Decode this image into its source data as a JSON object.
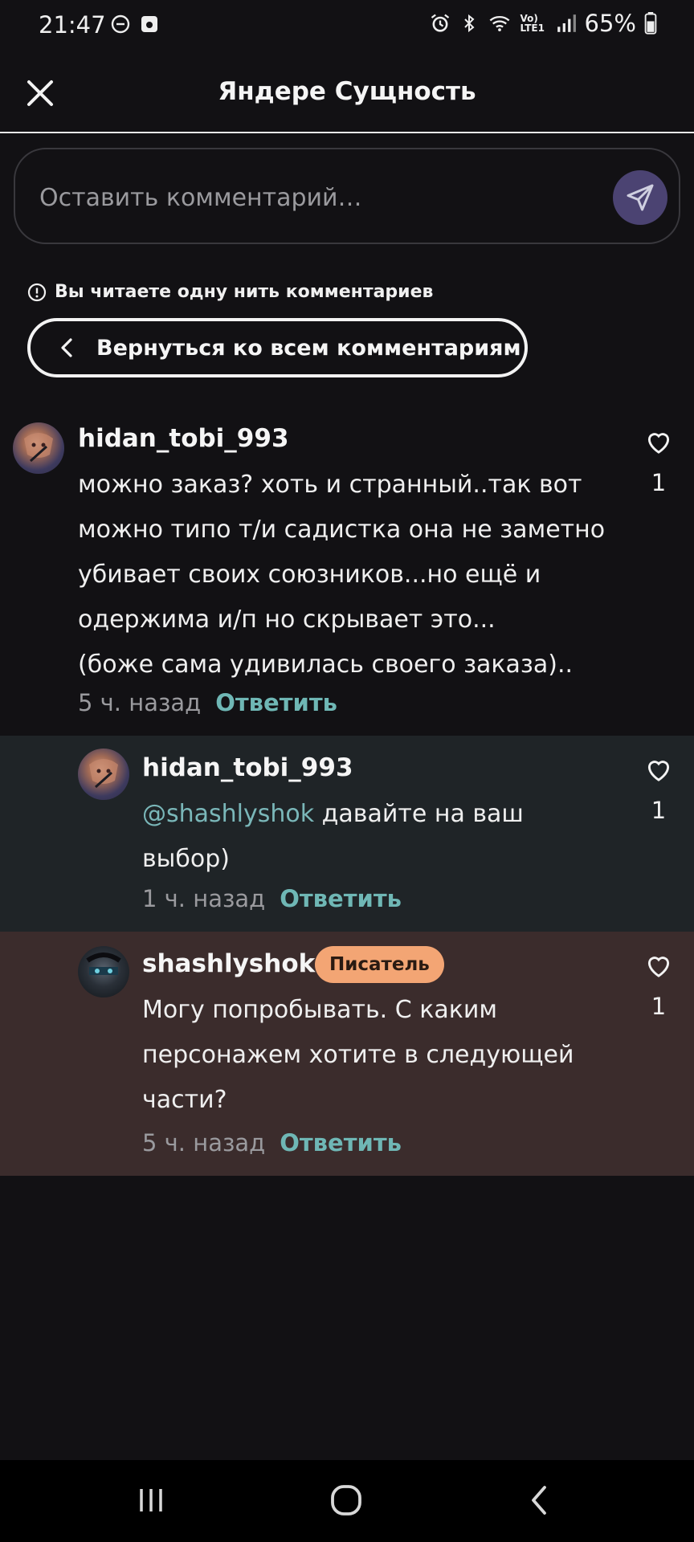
{
  "status_bar": {
    "time": "21:47",
    "battery": "65%",
    "network": "Vo) LTE1"
  },
  "header": {
    "title": "Яндере Сущность"
  },
  "comment_input": {
    "placeholder": "Оставить комментарий…"
  },
  "thread_notice": {
    "text": "Вы читаете одну нить комментариев",
    "back_label": "Вернуться ко всем комментариям"
  },
  "comments": [
    {
      "username": "hidan_tobi_993",
      "lines": [
        "можно заказ? хоть и странный..так вот",
        "можно типо т/и садистка она не заметно",
        "убивает своих союзников...но ещё и",
        "одержима и/п но скрывает это...",
        "(боже сама удивилась своего заказа).."
      ],
      "time": "5 ч. назад",
      "reply": "Ответить",
      "likes": "1"
    },
    {
      "username": "hidan_tobi_993",
      "mention": "@shashlyshok",
      "line1_rest": " давайте на ваш",
      "line2": "выбор)",
      "time": "1 ч. назад",
      "reply": "Ответить",
      "likes": "1"
    },
    {
      "username": "shashlyshok",
      "badge": "Писатель",
      "lines": [
        "Могу попробывать. С каким",
        "персонажем хотите в следующей",
        "части?"
      ],
      "time": "5 ч. назад",
      "reply": "Ответить",
      "likes": "1"
    }
  ],
  "colors": {
    "background": "#121114",
    "reply_bg": "#1f2427",
    "author_bg": "#3b2c2c",
    "accent_link": "#6fb7b5",
    "badge": "#f3a574",
    "send_button": "#4b4372"
  },
  "icons": [
    "close-icon",
    "send-icon",
    "info-icon",
    "chevron-left-icon",
    "heart-icon",
    "recents-icon",
    "home-icon",
    "back-icon"
  ]
}
